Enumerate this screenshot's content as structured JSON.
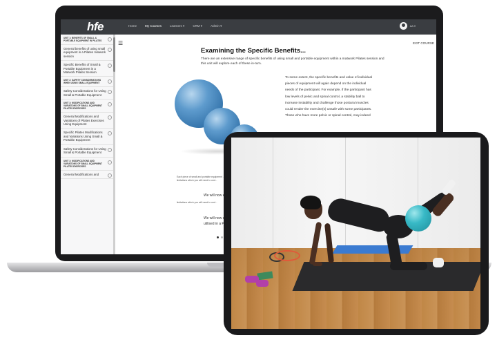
{
  "nav": {
    "logo": "hfe",
    "links": [
      "Home",
      "My Courses",
      "Learners ▾",
      "CRM ▾",
      "Admin ▾"
    ],
    "active_index": 1,
    "user_label": "AA ▾"
  },
  "sidebar": {
    "items": [
      {
        "unit": "UNIT 1: BENEFITS OF SMALL & PORTABLE EQUIPMENT IN PILATES",
        "title": ""
      },
      {
        "unit": "",
        "title": "General benefits of using small equipment in a Pilates matwork session"
      },
      {
        "unit": "",
        "title": "Specific Benefits of Small & Portable Equipment in a Matwork Pilates Session"
      },
      {
        "unit": "UNIT 2: SAFETY CONSIDERATIONS WHEN USING SMALL EQUIPMENT",
        "title": ""
      },
      {
        "unit": "",
        "title": "Safety Considerations for Using Small & Portable Equipment"
      },
      {
        "unit": "UNIT 3: MODIFICATIONS AND VARIATIONS OF SMALL EQUIPMENT PILATES EXERCISES",
        "title": ""
      },
      {
        "unit": "",
        "title": "General Modifications and Variations of Pilates Exercises Using Equipment"
      },
      {
        "unit": "",
        "title": "Specific Pilates Modifications and Variations Using Small & Portable Equipment"
      },
      {
        "unit": "",
        "title": "Safety Considerations for Using Small & Portable Equipment"
      },
      {
        "unit": "UNIT 3: MODIFICATIONS AND VARIATIONS OF SMALL EQUIPMENT PILATES EXERCISES",
        "title": ""
      },
      {
        "unit": "",
        "title": "General Modifications and"
      }
    ]
  },
  "main": {
    "exit_label": "EXIT COURSE",
    "title": "Examining the Specific Benefits...",
    "intro": "There are an extensive range of specific benefits of using small and portable equipment within a matwork Pilates session and this unit will explore each of these in-turn.",
    "body": "To some extent, the specific benefits and value of individual pieces of equipment will again depend on the individual needs of the participant. For example, if the participant has low levels of pelvic and spinal control, a stability ball to increase instability and challenge those postural muscles could render the exercise(s) unsafe with some participants. Those who have more pelvic or spinal control, may indeed",
    "caption1": "Each piece of small and portable equipment ... limitations which you will need to und...",
    "caption2": "limitations which you will need to und...",
    "we_will_1": "We will now e",
    "we_will_2a": "We will now e",
    "we_will_2b": "utilised in a Pi"
  }
}
